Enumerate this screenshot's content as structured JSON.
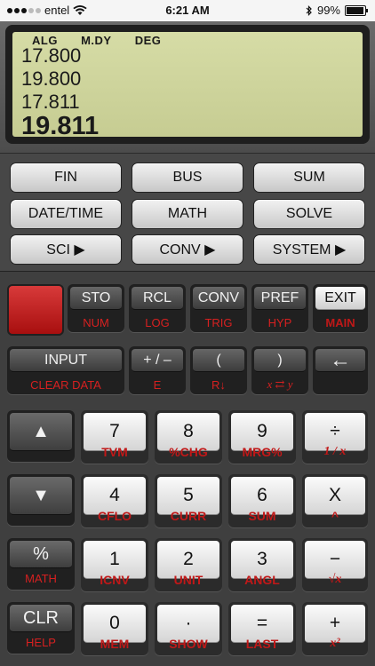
{
  "status_bar": {
    "carrier": "entel",
    "time": "6:21 AM",
    "battery": "99%"
  },
  "display": {
    "indicators": [
      "ALG",
      "M.DY",
      "DEG"
    ],
    "stack": [
      "17.800",
      "19.800",
      "17.811"
    ],
    "value": "19.811"
  },
  "menu": {
    "fin": "FIN",
    "bus": "BUS",
    "sum": "SUM",
    "datetime": "DATE/TIME",
    "math": "MATH",
    "solve": "SOLVE",
    "sci": "SCI ▶",
    "conv": "CONV ▶",
    "system": "SYSTEM ▶"
  },
  "keys": {
    "sto": {
      "main": "STO",
      "sub": "NUM"
    },
    "rcl": {
      "main": "RCL",
      "sub": "LOG"
    },
    "conv": {
      "main": "CONV",
      "sub": "TRIG"
    },
    "pref": {
      "main": "PREF",
      "sub": "HYP"
    },
    "exit": {
      "main": "EXIT",
      "sub": "MAIN"
    },
    "input": {
      "main": "INPUT",
      "sub": "CLEAR DATA"
    },
    "sign": {
      "main": "+ / –",
      "sub": "E"
    },
    "lparen": {
      "main": "(",
      "sub": "R↓"
    },
    "rparen": {
      "main": ")",
      "sub": "x ⇄ y"
    },
    "backspace": {
      "main": "←"
    },
    "up": {
      "main": "▲"
    },
    "down": {
      "main": "▼"
    },
    "percent": {
      "main": "%",
      "sub": "MATH"
    },
    "clr": {
      "main": "CLR",
      "sub": "HELP"
    },
    "seven": {
      "main": "7",
      "sub": "TVM"
    },
    "eight": {
      "main": "8",
      "sub": "%CHG"
    },
    "nine": {
      "main": "9",
      "sub": "MRG%"
    },
    "divide": {
      "main": "÷",
      "sub": "1 / x"
    },
    "four": {
      "main": "4",
      "sub": "CFLO"
    },
    "five": {
      "main": "5",
      "sub": "CURR"
    },
    "six": {
      "main": "6",
      "sub": "SUM"
    },
    "multiply": {
      "main": "X",
      "sub": "^"
    },
    "one": {
      "main": "1",
      "sub": "ICNV"
    },
    "two": {
      "main": "2",
      "sub": "UNIT"
    },
    "three": {
      "main": "3",
      "sub": "ANGL"
    },
    "minus": {
      "main": "−",
      "sub": "√x"
    },
    "zero": {
      "main": "0",
      "sub": "MEM"
    },
    "dot": {
      "main": "·",
      "sub": "SHOW"
    },
    "equals": {
      "main": "=",
      "sub": "LAST"
    },
    "plus": {
      "main": "+",
      "sub": "x²"
    }
  }
}
